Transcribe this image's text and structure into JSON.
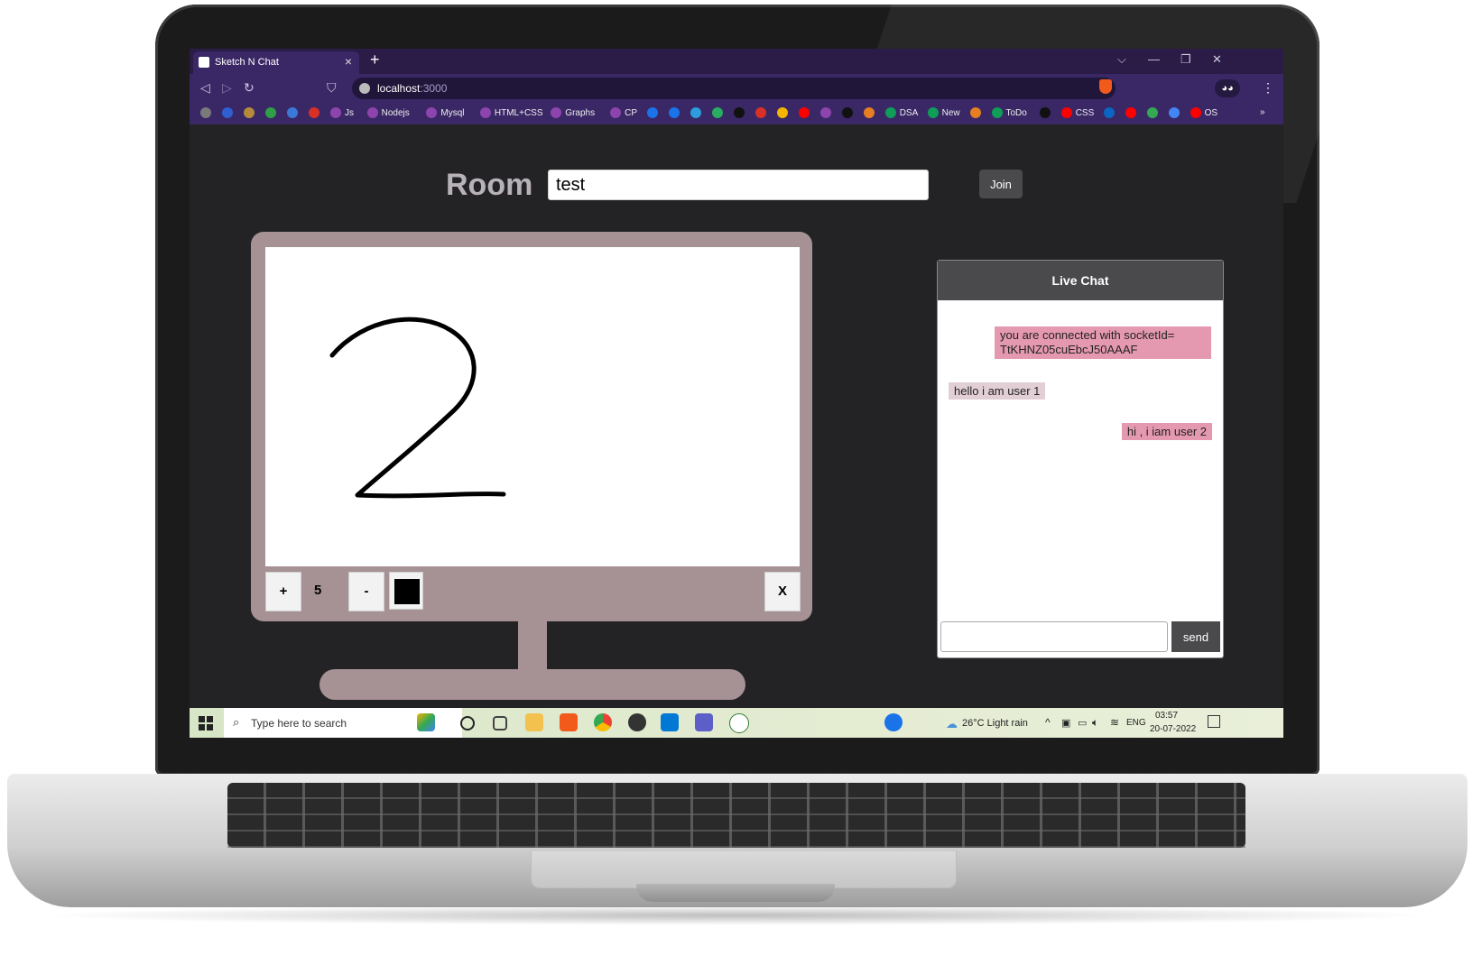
{
  "browser": {
    "tab_title": "Sketch N Chat",
    "tab_close": "×",
    "new_tab": "+",
    "window_controls": [
      "⌵",
      "—",
      "❐",
      "✕"
    ],
    "nav": {
      "back": "◁",
      "forward": "▷",
      "reload": "↻",
      "bookmark": "⛉"
    },
    "url_host": "localhost",
    "url_port": ":3000",
    "menu": "⋮",
    "bookmarks": [
      {
        "label": "",
        "color": "#7a7a7a"
      },
      {
        "label": "",
        "color": "#2f5fd0"
      },
      {
        "label": "",
        "color": "#b58b3a"
      },
      {
        "label": "",
        "color": "#2f9e44"
      },
      {
        "label": "",
        "color": "#3c78d8"
      },
      {
        "label": "",
        "color": "#d93025"
      },
      {
        "label": "Js",
        "color": "#8e44ad"
      },
      {
        "label": "Nodejs",
        "color": "#8e44ad"
      },
      {
        "label": "Mysql",
        "color": "#8e44ad"
      },
      {
        "label": "HTML+CSS",
        "color": "#8e44ad"
      },
      {
        "label": "Graphs",
        "color": "#8e44ad"
      },
      {
        "label": "CP",
        "color": "#8e44ad"
      },
      {
        "label": "",
        "color": "#1a73e8"
      },
      {
        "label": "",
        "color": "#1a73e8"
      },
      {
        "label": "",
        "color": "#2d9cdb"
      },
      {
        "label": "",
        "color": "#27ae60"
      },
      {
        "label": "",
        "color": "#111111"
      },
      {
        "label": "",
        "color": "#d93025"
      },
      {
        "label": "",
        "color": "#f4b400"
      },
      {
        "label": "",
        "color": "#ff0000"
      },
      {
        "label": "",
        "color": "#8e44ad"
      },
      {
        "label": "",
        "color": "#111111"
      },
      {
        "label": "",
        "color": "#e67e22"
      },
      {
        "label": "DSA",
        "color": "#0f9d58"
      },
      {
        "label": "New",
        "color": "#0f9d58"
      },
      {
        "label": "",
        "color": "#e67e22"
      },
      {
        "label": "ToDo",
        "color": "#0f9d58"
      },
      {
        "label": "",
        "color": "#111111"
      },
      {
        "label": "CSS",
        "color": "#ff0000"
      },
      {
        "label": "",
        "color": "#0a66c2"
      },
      {
        "label": "",
        "color": "#ff0000"
      },
      {
        "label": "",
        "color": "#34a853"
      },
      {
        "label": "",
        "color": "#4285f4"
      },
      {
        "label": "OS",
        "color": "#ff0000"
      }
    ],
    "bookmarks_more": "»"
  },
  "room": {
    "label": "Room",
    "value": "test",
    "join_label": "Join"
  },
  "whiteboard": {
    "plus_label": "+",
    "brush_size": "5",
    "minus_label": "-",
    "color": "#000000",
    "clear_label": "X",
    "frame_color": "#a69195"
  },
  "chat": {
    "title": "Live Chat",
    "messages": [
      {
        "text": "you are connected with socketId= TtKHNZ05cuEbcJ50AAAF",
        "side": "right"
      },
      {
        "text": "hello i am user 1",
        "side": "left"
      },
      {
        "text": "hi , i iam user 2",
        "side": "right"
      }
    ],
    "input_value": "",
    "send_label": "send"
  },
  "taskbar": {
    "search_placeholder": "Type here to search",
    "weather": "26°C  Light rain",
    "language": "ENG",
    "time": "03:57",
    "date": "20-07-2022"
  }
}
